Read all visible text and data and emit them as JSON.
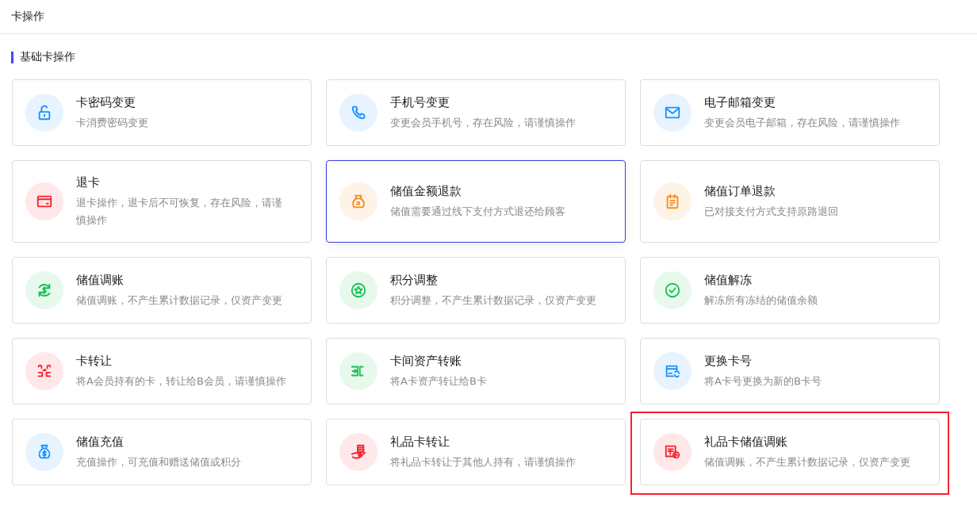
{
  "header": {
    "title": "卡操作"
  },
  "section": {
    "title": "基础卡操作"
  },
  "cards": [
    {
      "title": "卡密码变更",
      "description": "卡消费密码变更",
      "kind": "lock",
      "color": "#1890ff",
      "highlighted": false,
      "annotated": false
    },
    {
      "title": "手机号变更",
      "description": "变更会员手机号，存在风险，请谨慎操作",
      "kind": "phone",
      "color": "#1890ff",
      "highlighted": false,
      "annotated": false
    },
    {
      "title": "电子邮箱变更",
      "description": "变更会员电子邮箱，存在风险，请谨慎操作",
      "kind": "mail",
      "color": "#1890ff",
      "highlighted": false,
      "annotated": false
    },
    {
      "title": "退卡",
      "description": "退卡操作，退卡后不可恢复，存在风险，请谨慎操作",
      "kind": "card",
      "color": "#f5222d",
      "highlighted": false,
      "annotated": false
    },
    {
      "title": "储值金额退款",
      "description": "储值需要通过线下支付方式退还给顾客",
      "kind": "pot",
      "color": "#fa8c16",
      "highlighted": true,
      "annotated": false
    },
    {
      "title": "储值订单退款",
      "description": "已对接支付方式支持原路退回",
      "kind": "clipboard",
      "color": "#fa8c16",
      "highlighted": false,
      "annotated": false
    },
    {
      "title": "储值调账",
      "description": "储值调账，不产生累计数据记录，仅资产变更",
      "kind": "cycle-dollar",
      "color": "#13c152",
      "highlighted": false,
      "annotated": false
    },
    {
      "title": "积分调整",
      "description": "积分调整，不产生累计数据记录，仅资产变更",
      "kind": "star",
      "color": "#13c152",
      "highlighted": false,
      "annotated": false
    },
    {
      "title": "储值解冻",
      "description": "解冻所有冻结的储值余额",
      "kind": "check",
      "color": "#13c152",
      "highlighted": false,
      "annotated": false
    },
    {
      "title": "卡转让",
      "description": "将A会员持有的卡，转让给B会员，请谨慎操作",
      "kind": "transfer",
      "color": "#f5222d",
      "highlighted": false,
      "annotated": false
    },
    {
      "title": "卡间资产转账",
      "description": "将A卡资产转让给B卡",
      "kind": "card-transfer",
      "color": "#13c152",
      "highlighted": false,
      "annotated": false
    },
    {
      "title": "更换卡号",
      "description": "将A卡号更换为新的B卡号",
      "kind": "card-swap",
      "color": "#1890ff",
      "highlighted": false,
      "annotated": false
    },
    {
      "title": "储值充值",
      "description": "充值操作，可充值和赠送储值或积分",
      "kind": "money-bag",
      "color": "#1890ff",
      "highlighted": false,
      "annotated": false
    },
    {
      "title": "礼品卡转让",
      "description": "将礼品卡转让于其他人持有，请谨慎操作",
      "kind": "hand",
      "color": "#f5222d",
      "highlighted": false,
      "annotated": false
    },
    {
      "title": "礼品卡储值调账",
      "description": "储值调账，不产生累计数据记录，仅资产变更",
      "kind": "gift-swap",
      "color": "#f5222d",
      "highlighted": false,
      "annotated": true
    }
  ]
}
